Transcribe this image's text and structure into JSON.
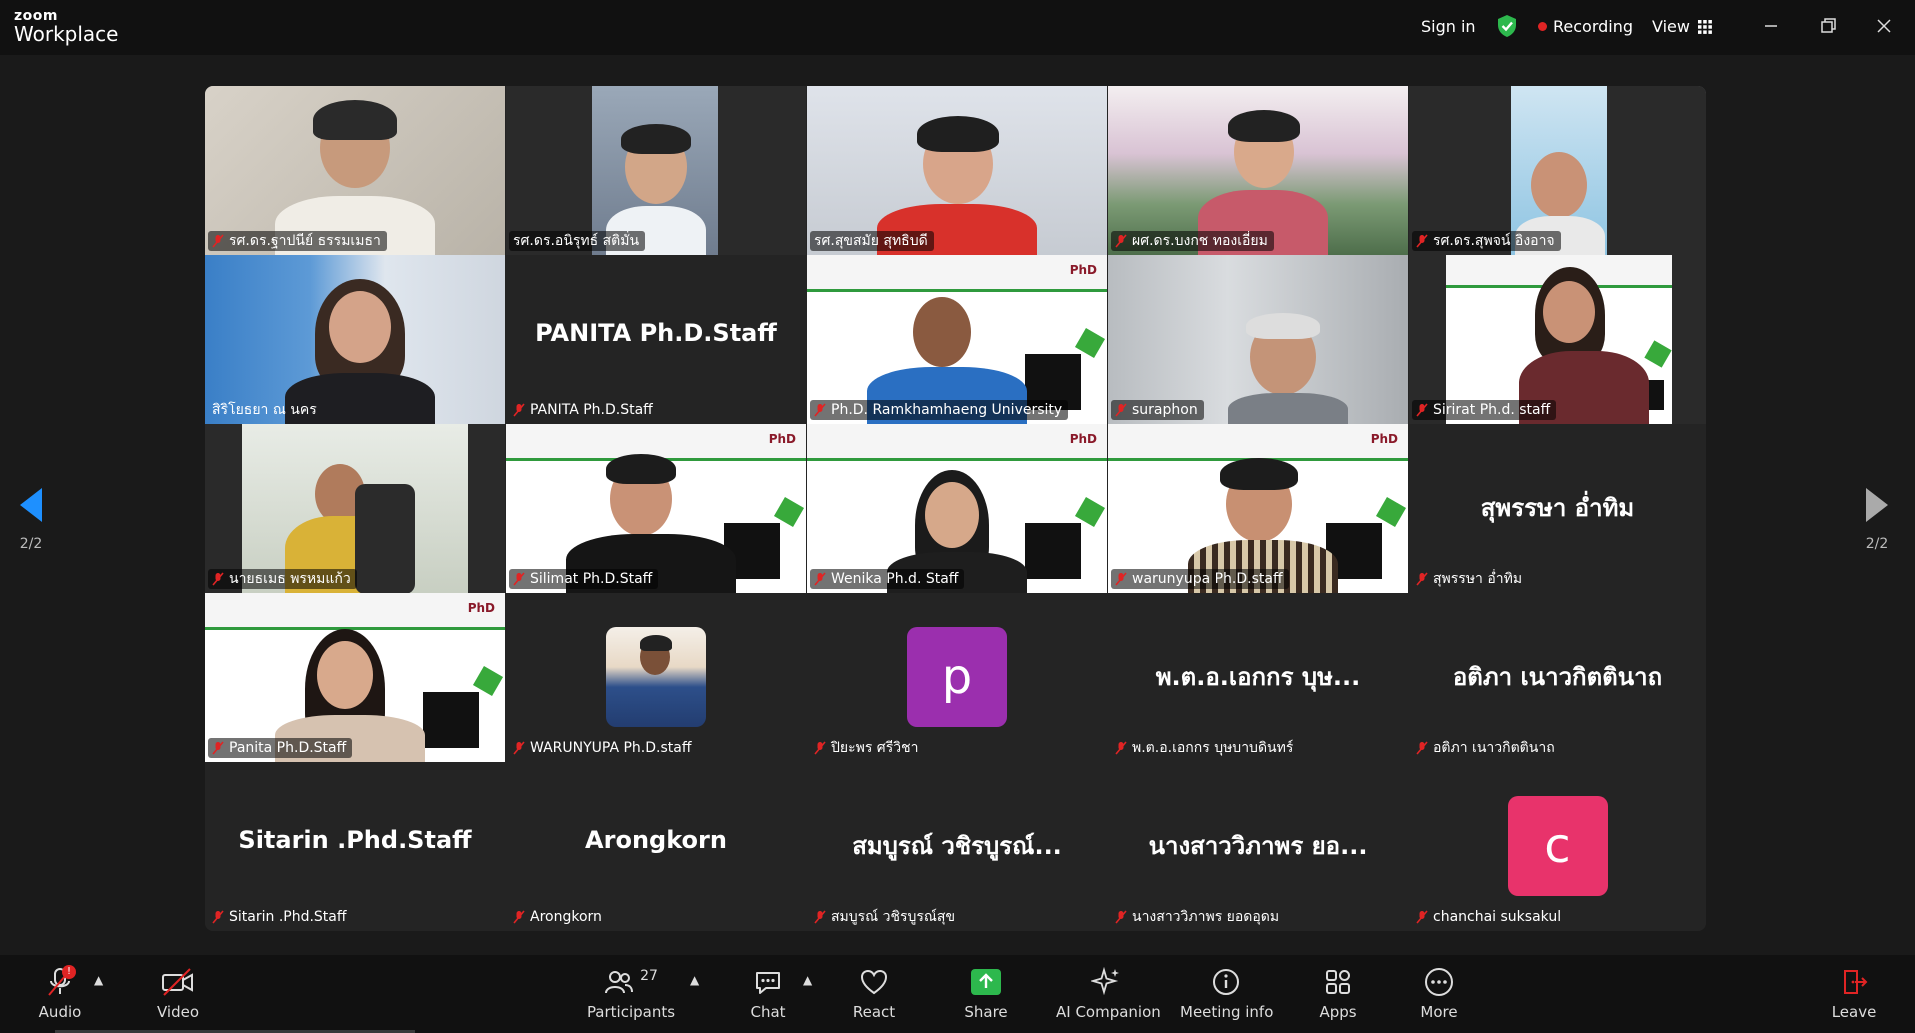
{
  "app": {
    "brand_top": "zoom",
    "brand_bottom": "Workplace"
  },
  "topbar": {
    "sign_in": "Sign in",
    "recording": "Recording",
    "view": "View"
  },
  "pager": {
    "left": "2/2",
    "right": "2/2"
  },
  "tiles": [
    {
      "name": "รศ.ดร.ฐาปนีย์ ธรรมเมธา",
      "muted": true
    },
    {
      "name": "รศ.ดร.อนิรุทธ์ สติมั่น",
      "muted": false
    },
    {
      "name": "รศ.สุขสมัย สุทธิบดี",
      "muted": false
    },
    {
      "name": "ผศ.ดร.บงกช ทองเอี่ยม",
      "muted": true
    },
    {
      "name": "รศ.ดร.สุพจน์ อิงอาจ",
      "muted": true
    },
    {
      "name": "สิริโยธยา ณ นคร",
      "muted": false
    },
    {
      "name": "PANITA Ph.D.Staff",
      "big": "PANITA Ph.D.Staff",
      "muted": true
    },
    {
      "name": "Ph.D. Ramkhamhaeng University",
      "muted": true
    },
    {
      "name": "suraphon",
      "muted": true
    },
    {
      "name": "Sirirat Ph.d. staff",
      "muted": true
    },
    {
      "name": "นายธเมธ พรหมแก้ว",
      "muted": true
    },
    {
      "name": "Silimat Ph.D.Staff",
      "muted": true
    },
    {
      "name": "Wenika Ph.d. Staff",
      "muted": true
    },
    {
      "name": "warunyupa Ph.D.staff",
      "muted": true
    },
    {
      "name": "สุพรรษา อ่ำทิม",
      "big": "สุพรรษา อ่ำทิม",
      "muted": true
    },
    {
      "name": "Panita Ph.D.Staff",
      "muted": true
    },
    {
      "name": "WARUNYUPA Ph.D.staff",
      "muted": true
    },
    {
      "name": "ปิยะพร ศรีวิชา",
      "avatar_letter": "p",
      "avatar_color": "#9b2fae",
      "muted": true
    },
    {
      "name": "พ.ต.อ.เอกกร บุษบาบดินทร์",
      "big": "พ.ต.อ.เอกกร บุษ...",
      "muted": true
    },
    {
      "name": "อติภา เนาวกิตตินาถ",
      "big": "อติภา เนาวกิตตินาถ",
      "muted": true
    },
    {
      "name": "Sitarin .Phd.Staff",
      "big": "Sitarin .Phd.Staff",
      "muted": true
    },
    {
      "name": "Arongkorn",
      "big": "Arongkorn",
      "muted": true
    },
    {
      "name": "สมบูรณ์ วชิรบูรณ์สุข",
      "big": "สมบูรณ์ วชิรบูรณ์...",
      "muted": true
    },
    {
      "name": "นางสาววิภาพร ยอดอุดม",
      "big": "นางสาววิภาพร ยอ...",
      "muted": true
    },
    {
      "name": "chanchai suksakul",
      "avatar_letter": "c",
      "avatar_color": "#e8336b",
      "muted": true
    }
  ],
  "toolbar": {
    "audio": "Audio",
    "audio_badge": "!",
    "video": "Video",
    "participants": "Participants",
    "participants_count": "27",
    "chat": "Chat",
    "react": "React",
    "share": "Share",
    "ai_companion": "AI Companion",
    "meeting_info": "Meeting info",
    "apps": "Apps",
    "more": "More",
    "leave": "Leave"
  },
  "colors": {
    "active_speaker": "#23d18b",
    "recording_dot": "#e02424",
    "share_green": "#2db84d",
    "pager_active": "#1e90ff"
  }
}
